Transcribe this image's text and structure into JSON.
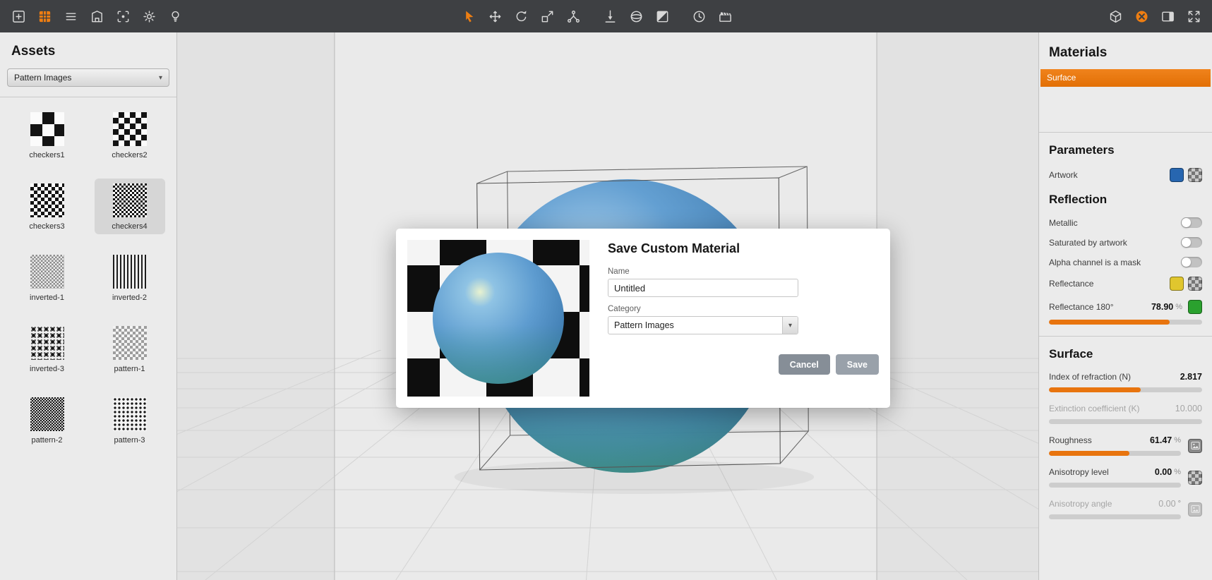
{
  "colors": {
    "accent": "#e8740e",
    "toolbar_bg": "#3e4043",
    "panel_bg": "#ebebeb",
    "layer_selected": "#e8780d"
  },
  "toolbar": {
    "left_icons": [
      {
        "name": "new-scene-icon"
      },
      {
        "name": "asset-browser-icon",
        "active": true
      },
      {
        "name": "menu-icon"
      },
      {
        "name": "printer-icon"
      },
      {
        "name": "snapshot-icon"
      },
      {
        "name": "settings-gear-icon"
      },
      {
        "name": "light-icon"
      }
    ],
    "tool_icons": [
      {
        "name": "select-cursor-icon",
        "active": true
      },
      {
        "name": "move-icon"
      },
      {
        "name": "rotate-icon"
      },
      {
        "name": "scale-icon"
      },
      {
        "name": "hierarchy-icon"
      }
    ],
    "view_icons": [
      {
        "name": "measure-icon"
      },
      {
        "name": "environment-icon"
      },
      {
        "name": "contrast-icon"
      }
    ],
    "anim_icons": [
      {
        "name": "time-icon"
      },
      {
        "name": "clapperboard-icon"
      }
    ],
    "right_icons": [
      {
        "name": "scene-cube-icon"
      },
      {
        "name": "materials-editor-icon",
        "active": true
      },
      {
        "name": "panel-layout-icon"
      },
      {
        "name": "fullscreen-icon"
      }
    ]
  },
  "assets_panel": {
    "title": "Assets",
    "category_dropdown": {
      "value": "Pattern Images"
    },
    "items": [
      {
        "label": "checkers1",
        "pattern": "checker-xl"
      },
      {
        "label": "checkers2",
        "pattern": "checker-lg"
      },
      {
        "label": "checkers3",
        "pattern": "checker-md"
      },
      {
        "label": "checkers4",
        "pattern": "checker-sm",
        "selected": true
      },
      {
        "label": "inverted-1",
        "pattern": "fine-gray"
      },
      {
        "label": "inverted-2",
        "pattern": "stripes"
      },
      {
        "label": "inverted-3",
        "pattern": "ornate"
      },
      {
        "label": "pattern-1",
        "pattern": "fine-light"
      },
      {
        "label": "pattern-2",
        "pattern": "dense"
      },
      {
        "label": "pattern-3",
        "pattern": "dots"
      }
    ]
  },
  "dialog": {
    "title": "Save Custom Material",
    "name_label": "Name",
    "name_value": "Untitled",
    "category_label": "Category",
    "category_value": "Pattern Images",
    "cancel_label": "Cancel",
    "save_label": "Save"
  },
  "materials_panel": {
    "title": "Materials",
    "layers": [
      {
        "label": "Surface",
        "selected": true
      }
    ],
    "sections": [
      {
        "title": "Parameters",
        "divider": true,
        "rows": [
          {
            "type": "swatches",
            "label": "Artwork",
            "swatches": [
              "color:#2766b0",
              "texture"
            ]
          }
        ]
      },
      {
        "title": "Reflection",
        "divider": false,
        "rows": [
          {
            "type": "toggle",
            "label": "Metallic",
            "on": false
          },
          {
            "type": "toggle",
            "label": "Saturated by artwork",
            "on": false
          },
          {
            "type": "toggle",
            "label": "Alpha channel is a mask",
            "on": false
          },
          {
            "type": "swatches",
            "label": "Reflectance",
            "swatches": [
              "color:#e0c62e",
              "texture"
            ]
          },
          {
            "type": "slider",
            "label": "Reflectance 180°",
            "value": "78.90",
            "unit": "%",
            "pct": 79,
            "swatch": "color:#2aa12e",
            "swatch_pos": "head",
            "enabled": true
          }
        ]
      },
      {
        "title": "Surface",
        "divider": true,
        "rows": [
          {
            "type": "slider",
            "label": "Index of refraction (N)",
            "value": "2.817",
            "unit": "",
            "pct": 60,
            "enabled": true
          },
          {
            "type": "slider",
            "label": "Extinction coefficient (K)",
            "value": "10.000",
            "unit": "",
            "pct": 0,
            "enabled": false
          },
          {
            "type": "slider",
            "label": "Roughness",
            "value": "61.47",
            "unit": "%",
            "pct": 61,
            "swatch": "image",
            "enabled": true
          },
          {
            "type": "slider",
            "label": "Anisotropy level",
            "value": "0.00",
            "unit": "%",
            "pct": 0,
            "swatch": "texture",
            "enabled": true
          },
          {
            "type": "slider",
            "label": "Anisotropy angle",
            "value": "0.00",
            "unit": "°",
            "pct": 0,
            "swatch": "image",
            "enabled": false
          }
        ]
      }
    ]
  }
}
